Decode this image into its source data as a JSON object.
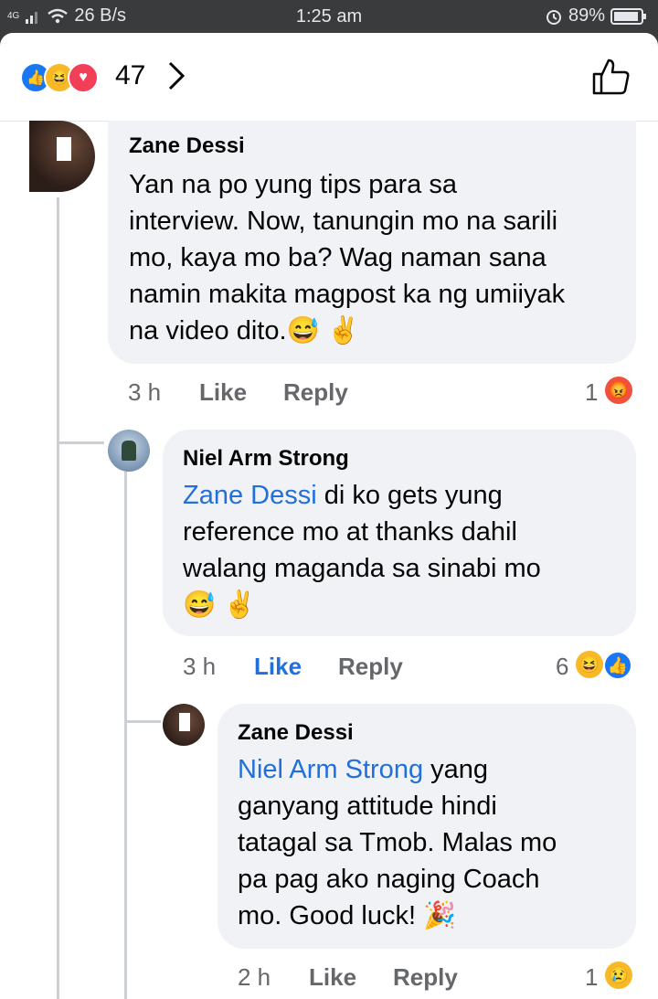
{
  "status": {
    "network": "4G",
    "speed": "26 B/s",
    "time": "1:25 am",
    "battery": "89%"
  },
  "header": {
    "reaction_count": "47",
    "reactions": [
      "like",
      "haha",
      "love"
    ]
  },
  "comments": [
    {
      "author": "Zane Dessi",
      "lines": [
        "Yan na po yung tips para sa",
        "interview. Now, tanungin mo na sarili",
        "mo, kaya mo ba? Wag naman sana",
        "namin makita magpost ka ng umiiyak",
        "na video dito."
      ],
      "time": "3 h",
      "like_label": "Like",
      "reply_label": "Reply",
      "reaction_count": "1"
    },
    {
      "author": "Niel Arm Strong",
      "mention": "Zane Dessi",
      "lines": [
        " di ko gets yung",
        "reference mo at thanks dahil",
        "walang maganda sa sinabi mo"
      ],
      "time": "3 h",
      "like_label": "Like",
      "reply_label": "Reply",
      "reaction_count": "6"
    },
    {
      "author": "Zane Dessi",
      "mention": "Niel Arm Strong",
      "lines": [
        " yang",
        "ganyang attitude hindi",
        "tatagal sa Tmob. Malas mo",
        "pa pag ako naging Coach",
        "mo. Good luck!"
      ],
      "time": "2 h",
      "like_label": "Like",
      "reply_label": "Reply",
      "reaction_count": "1"
    }
  ],
  "colors": {
    "accent": "#216fdb",
    "bubble": "#f0f2f5",
    "meta": "#65676b"
  }
}
